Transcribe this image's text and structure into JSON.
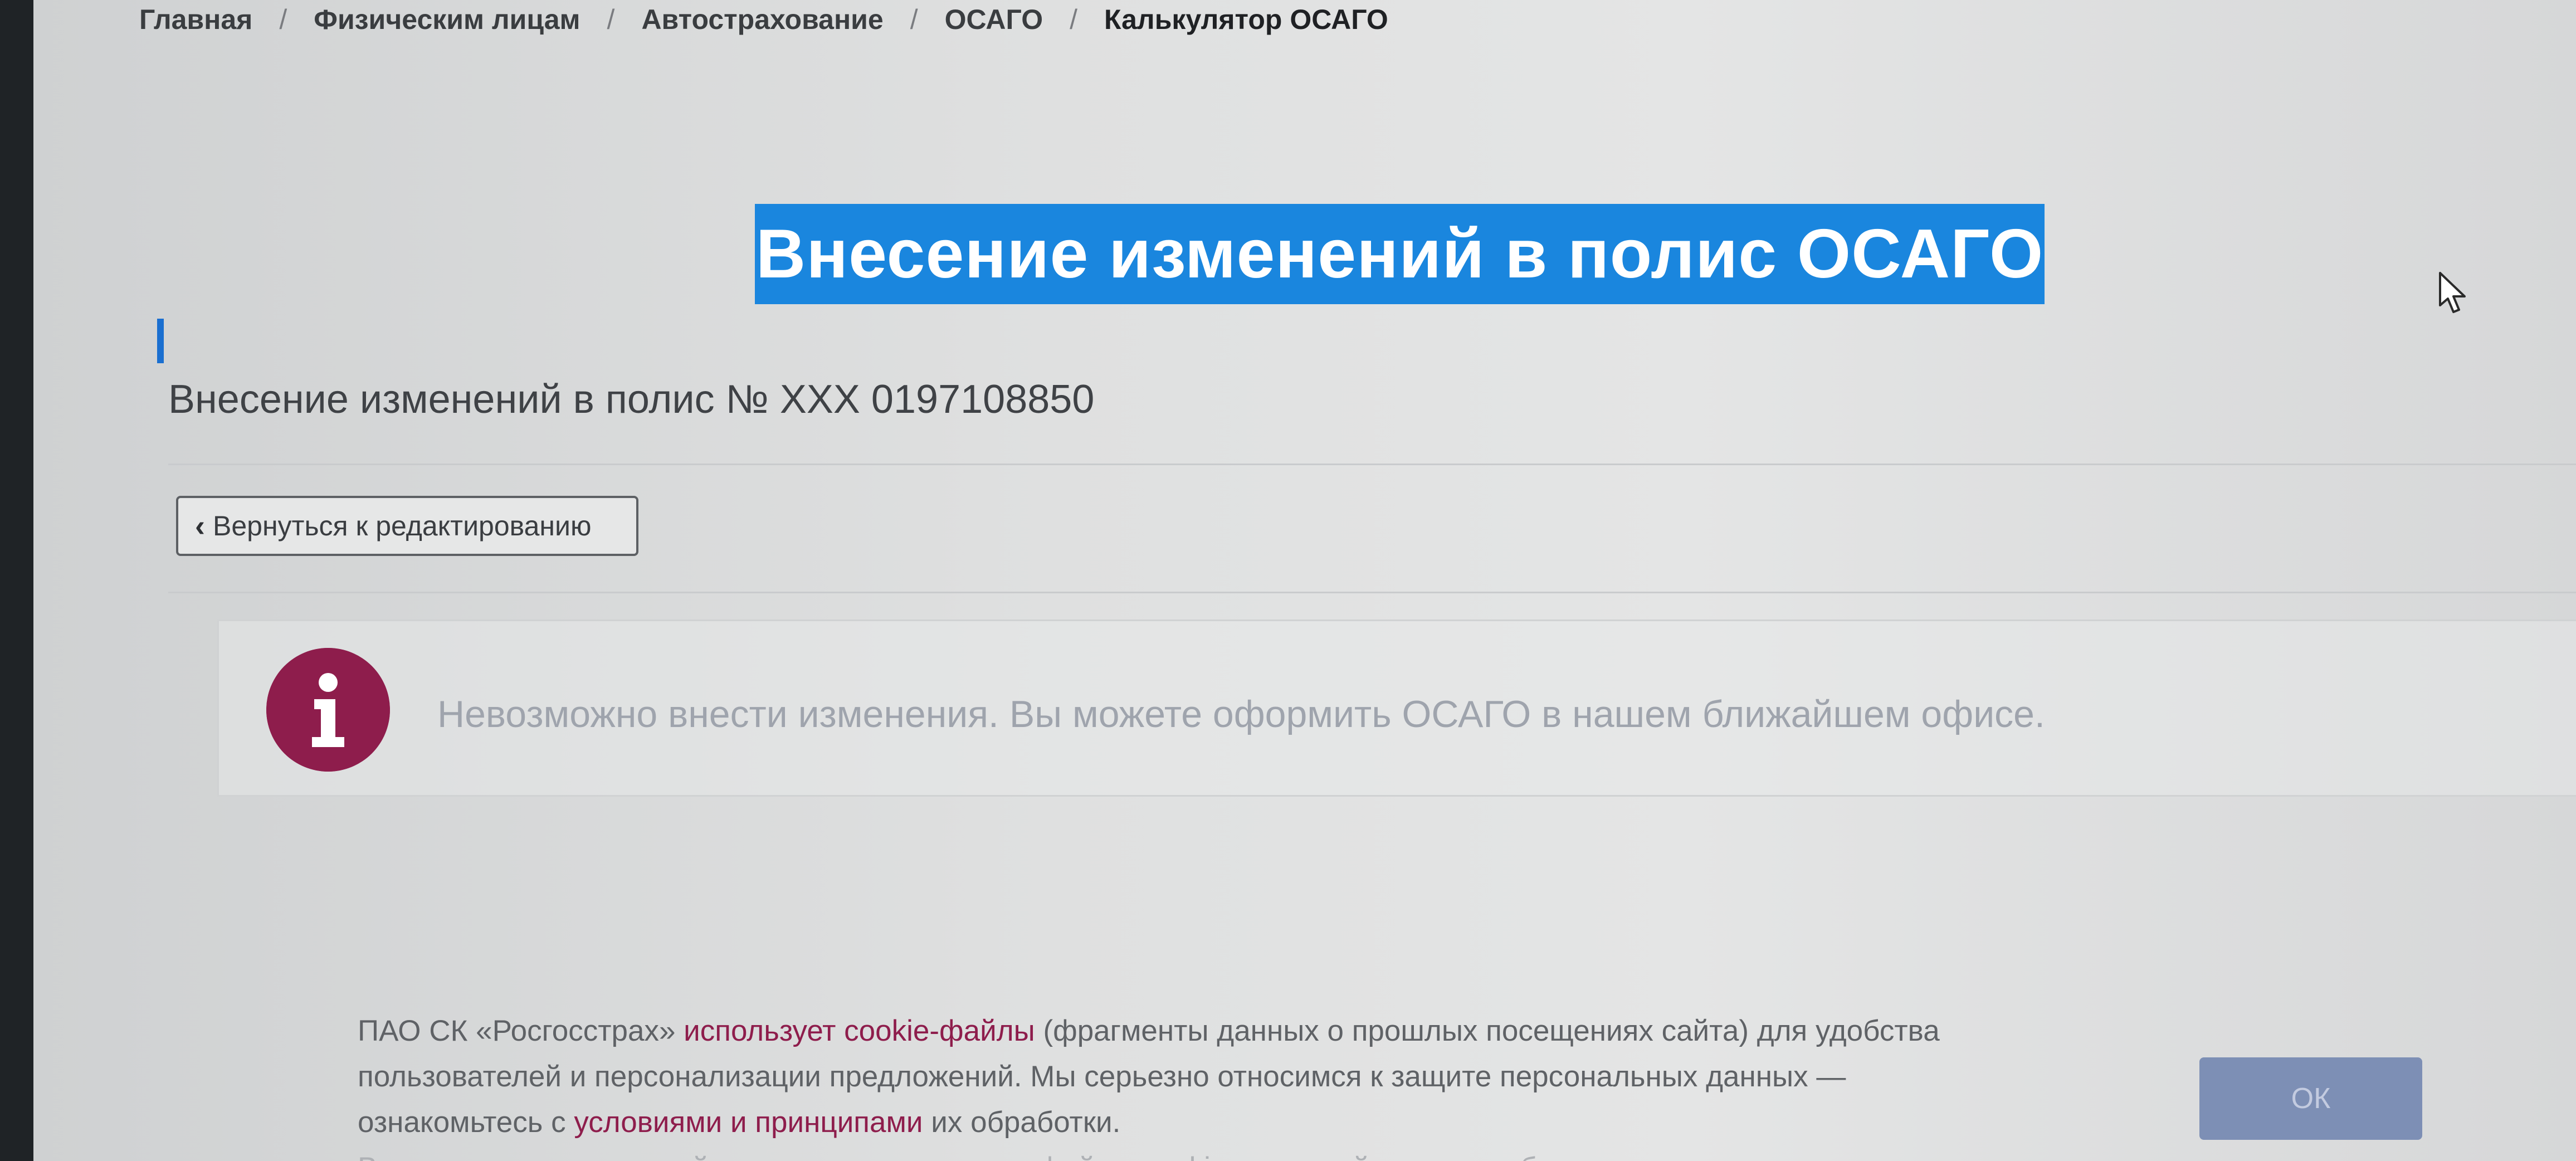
{
  "breadcrumb": {
    "items": [
      "Главная",
      "Физическим лицам",
      "Автострахование",
      "ОСАГО"
    ],
    "separator": "/",
    "current": "Калькулятор ОСАГО"
  },
  "page": {
    "title": "Внесение изменений в полис ОСАГО",
    "subtitle": "Внесение изменений в полис № ХХХ 0197108850"
  },
  "back_button": {
    "label": "Вернуться к редактированию"
  },
  "alert": {
    "icon": "info-icon",
    "message": "Невозможно внести изменения. Вы можете оформить ОСАГО в нашем ближайшем офисе."
  },
  "cookie_banner": {
    "company": "ПАО СК «Росгосстрах»",
    "uses_link": "использует cookie-файлы",
    "line1_rest": "(фрагменты данных о прошлых посещениях сайта) для удобства",
    "line2": "пользователей и персонализации предложений. Мы серьезно относимся к защите персональных данных —",
    "line3_start": "ознакомьтесь с",
    "terms_link": "условиями и принципами",
    "line3_end": "их обработки.",
    "line4": "Вы можете запретить сайтам сохранять и читать файлы cookie в настройках своего браузера.",
    "ok_label": "ОК"
  },
  "colors": {
    "title_highlight": "#1a86de",
    "brand_accent": "#8e1d4c",
    "ok_button": "#7d8fb5"
  }
}
